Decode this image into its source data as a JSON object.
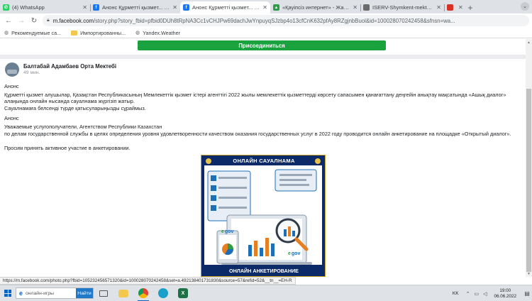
{
  "tabs": [
    {
      "title": "(4) WhatsApp",
      "favicon_color": "#25d366",
      "favicon_glyph": "✆",
      "active": false
    },
    {
      "title": "Анонс Құрметті қызмет... - Би",
      "favicon_color": "#1877f2",
      "favicon_glyph": "f",
      "active": false
    },
    {
      "title": "Анонс Құрметті қызмет... - Би",
      "favicon_color": "#1877f2",
      "favicon_glyph": "f",
      "active": true
    },
    {
      "title": "«Қауіпсіз интернет» - Жамбы",
      "favicon_color": "#2e9d4a",
      "favicon_glyph": "▲",
      "active": false
    },
    {
      "title": "ISERV-Shymkent-mektebi.kz -",
      "favicon_color": "#6a6a6a",
      "favicon_glyph": "",
      "active": false
    },
    {
      "title": "",
      "favicon_color": "#d93025",
      "favicon_glyph": "",
      "active": false
    }
  ],
  "toolbar": {
    "host": "m.facebook.com",
    "path": "/story.php?story_fbid=pfbid0DUh8tRpNA3Cc1vCHJPw69dachJwYnpuyqSJzbp4o13cfCnK632pfAy8RZgjnbBuol&id=100028070242458&sfnsn=wa..."
  },
  "bookmarks": [
    {
      "label": "Рекомендуемые са...",
      "icon": "globe-icon"
    },
    {
      "label": "Импортированны...",
      "icon": "folder-icon"
    },
    {
      "label": "Yandex.Weather",
      "icon": "globe-icon"
    }
  ],
  "page": {
    "join_label": "Присоединиться",
    "author": "Балтабай Адамбаев Орта Мектебі",
    "time": "49 мин.",
    "post_lines": [
      "Анонс",
      "Құрметті қызмет алушылар, Қазақстан Республикасының Мемлекеттік қызмет істері агенттігі 2022 жылы мемлекеттік қызметтерді көрсету сапасымен қанағаттану деңгейін анықтау мақсатында «Ашық диалог» алаңында онлайн нысанда сауалнама жүргізіп жатыр.",
      "Сауалнамаға белсенді түрде қатысуларыңызды сұраймыз.",
      "Анонс",
      "Уважаемые услугополучатели, Агентством Республики Казахстан",
      "по делам государственной службы в целях определения уровня удовлетворенности качеством оказания государственных услуг в 2022 году проводится онлайн анкетирование на площадке «Открытый диалог».",
      "Просим принять активное участие в анкетировании."
    ],
    "image_header": "ОНЛАЙН САУАЛНАМА",
    "image_footer": "ОНЛАЙН АНКЕТИРОВАНИЕ",
    "egov_label_1": "e",
    "egov_label_2": "gov"
  },
  "status_url": "https://m.facebook.com/photo.php?fbid=105232456571320&id=100028070242458&set=a.492138401731830&source=57&refid=52&__tn__=EH-R",
  "taskbar": {
    "search_text": "онлайн-игры",
    "search_button": "Найти",
    "lang": "KK",
    "time": "19:00",
    "date": "06.06.2022"
  },
  "colors": {
    "join_green": "#1aa23f",
    "fb_blue": "#1877f2",
    "image_navy": "#0b2a67",
    "gold": "#c9a227"
  }
}
